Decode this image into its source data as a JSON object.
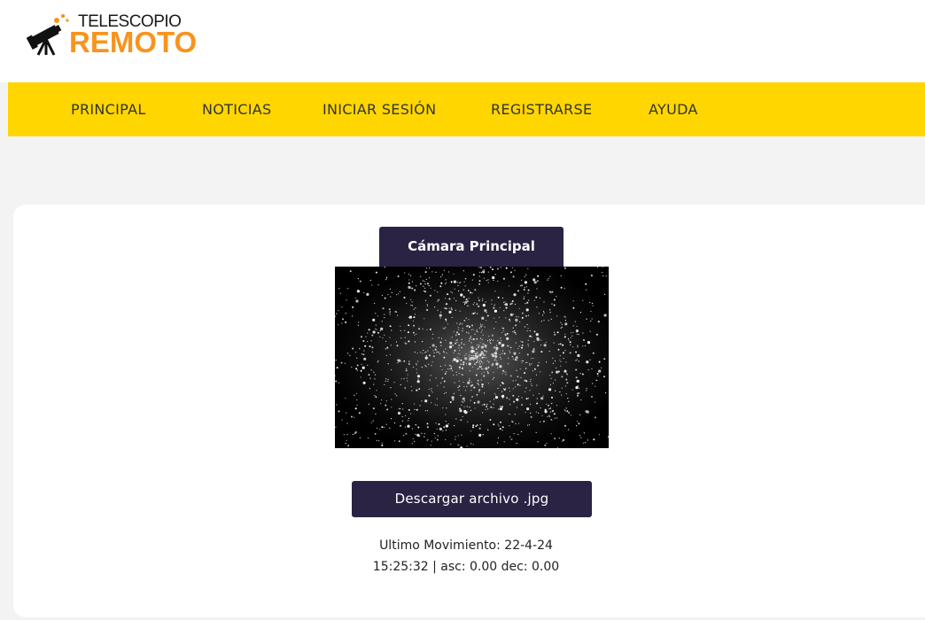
{
  "brand": {
    "line1": "TELESCOPIO",
    "line2": "REMOTO",
    "accent_color": "#f7941d",
    "icon": "telescope-icon"
  },
  "nav": {
    "background": "#ffd600",
    "items": [
      {
        "label": "PRINCIPAL"
      },
      {
        "label": "NOTICIAS"
      },
      {
        "label": "INICIAR SESIÓN"
      },
      {
        "label": "REGISTRARSE"
      },
      {
        "label": "AYUDA"
      }
    ]
  },
  "camera": {
    "tab_label": "Cámara Principal",
    "image_alt": "Imagen de cámara",
    "download_label": "Descargar archivo .jpg",
    "status_line1": "Ultimo Movimiento: 22-4-24",
    "status_line2": "15:25:32 | asc: 0.00 dec: 0.00",
    "theme_color": "#2a2343"
  }
}
